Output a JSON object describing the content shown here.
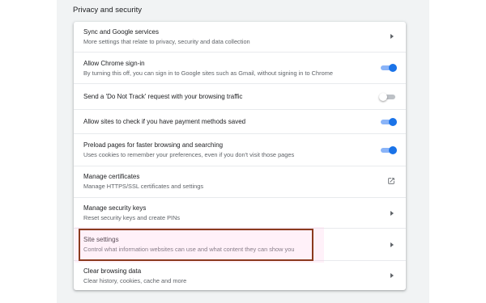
{
  "section": {
    "title": "Privacy and security"
  },
  "rows": [
    {
      "title": "Sync and Google services",
      "subtitle": "More settings that relate to privacy, security and data collection",
      "control": "arrow"
    },
    {
      "title": "Allow Chrome sign-in",
      "subtitle": "By turning this off, you can sign in to Google sites such as Gmail, without signing in to Chrome",
      "control": "toggle",
      "toggle_state": "on"
    },
    {
      "title": "Send a 'Do Not Track' request with your browsing traffic",
      "subtitle": "",
      "control": "toggle",
      "toggle_state": "off"
    },
    {
      "title": "Allow sites to check if you have payment methods saved",
      "subtitle": "",
      "control": "toggle",
      "toggle_state": "on"
    },
    {
      "title": "Preload pages for faster browsing and searching",
      "subtitle": "Uses cookies to remember your preferences, even if you don't visit those pages",
      "control": "toggle",
      "toggle_state": "on"
    },
    {
      "title": "Manage certificates",
      "subtitle": "Manage HTTPS/SSL certificates and settings",
      "control": "external-link"
    },
    {
      "title": "Manage security keys",
      "subtitle": "Reset security keys and create PINs",
      "control": "arrow"
    },
    {
      "title": "Site settings",
      "subtitle": "Control what information websites can use and what content they can show you",
      "control": "arrow"
    },
    {
      "title": "Clear browsing data",
      "subtitle": "Clear history, cookies, cache and more",
      "control": "arrow"
    }
  ],
  "colors": {
    "accent": "#1a73e8",
    "highlight_border": "#8b3a1e"
  }
}
